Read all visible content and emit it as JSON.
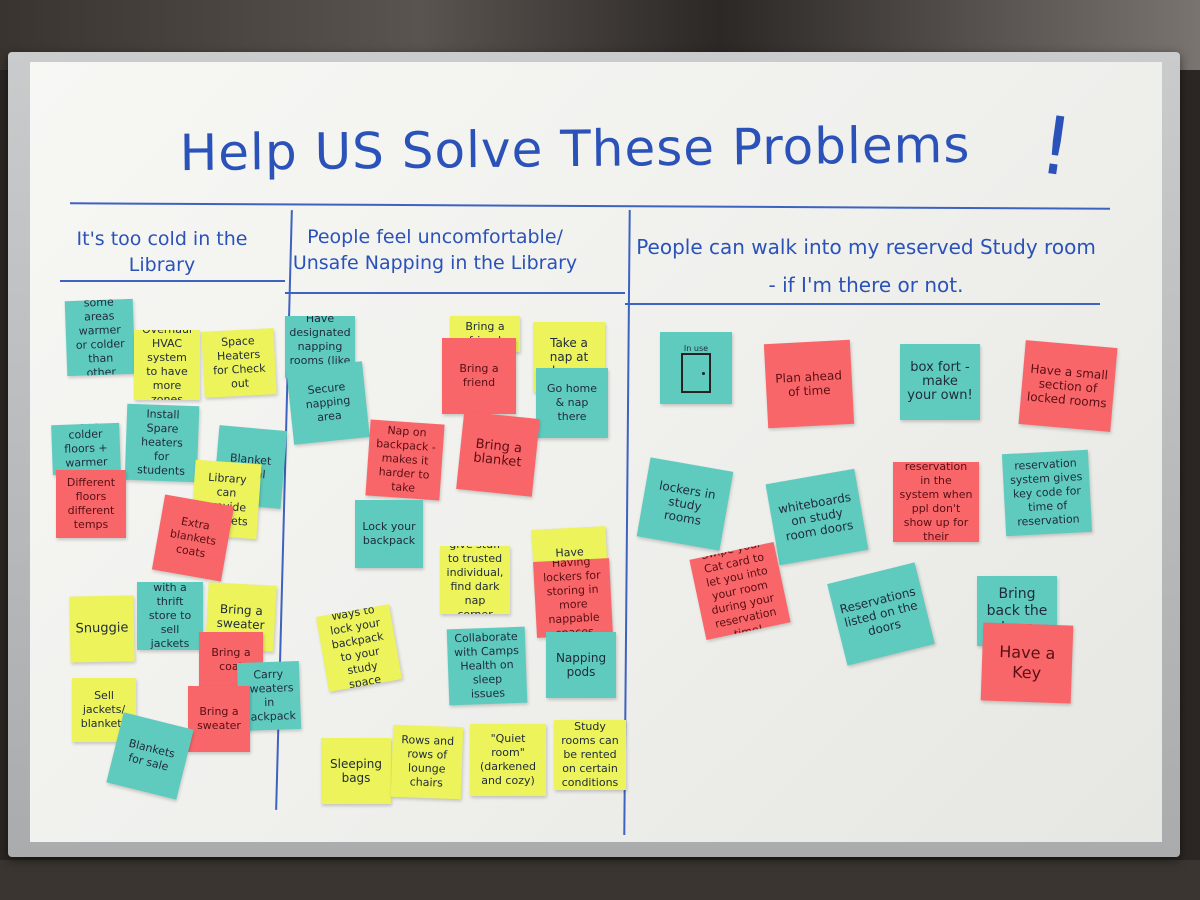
{
  "title": "Help US Solve These Problems",
  "title_bang": "!",
  "columns": [
    {
      "heading": "It's too cold in the Library"
    },
    {
      "heading": "People feel uncomfortable/ Unsafe Napping in the Library"
    },
    {
      "heading": "People can walk into my reserved Study room - if I'm there or not."
    }
  ],
  "notes": {
    "c1": [
      "Make some areas warmer or colder than other rooms",
      "Overhaul HVAC system to have more zones",
      "Space Heaters for Check out",
      "Install Spare heaters for students",
      "Have colder floors + warmer floors",
      "Blanket rental",
      "Different floors different temps",
      "Library can provide blankets",
      "Extra blankets coats",
      "Snuggie",
      "partner with a thrift store to sell jackets sweaters",
      "Bring a sweater",
      "Bring a coat",
      "Carry sweaters in backpack",
      "Sell jackets/ blankets",
      "Bring a sweater",
      "Blankets for sale"
    ],
    "c2": [
      "Have designated napping rooms (like Google)",
      "Secure napping area",
      "Bring a friend",
      "Bring a friend",
      "Take a nap at home",
      "Go home & nap there",
      "Nap on backpack - makes it harder to take",
      "Bring a blanket",
      "Lock your backpack",
      "give stuff to trusted individual, find dark nap corner",
      "Have lockers",
      "Having lockers for storing in more nappable spaces",
      "Ways to lock your backpack to your study space",
      "Collaborate with Camps Health on sleep issues",
      "Napping pods",
      "Sleeping bags",
      "Rows and rows of lounge chairs",
      "\"Quiet room\" (darkened and cozy)",
      "Study rooms can be rented on certain conditions"
    ],
    "c3": [
      "In use",
      "Plan ahead of time",
      "box fort - make your own!",
      "Have a small section of locked rooms",
      "lockers in study rooms",
      "whiteboards on study room doors",
      "Cancel reservation in the system when ppl don't show up for their reservation",
      "reservation system gives key code for time of reservation",
      "Swipe your Cat card to let you into your room during your reservation time!",
      "Reservations listed on the doors",
      "Bring back the keys",
      "Have a Key"
    ]
  },
  "colors": {
    "teal": "#5fcbbf",
    "yellow": "#ecf35b",
    "pink": "#f8666a",
    "marker": "#2a52b8"
  }
}
